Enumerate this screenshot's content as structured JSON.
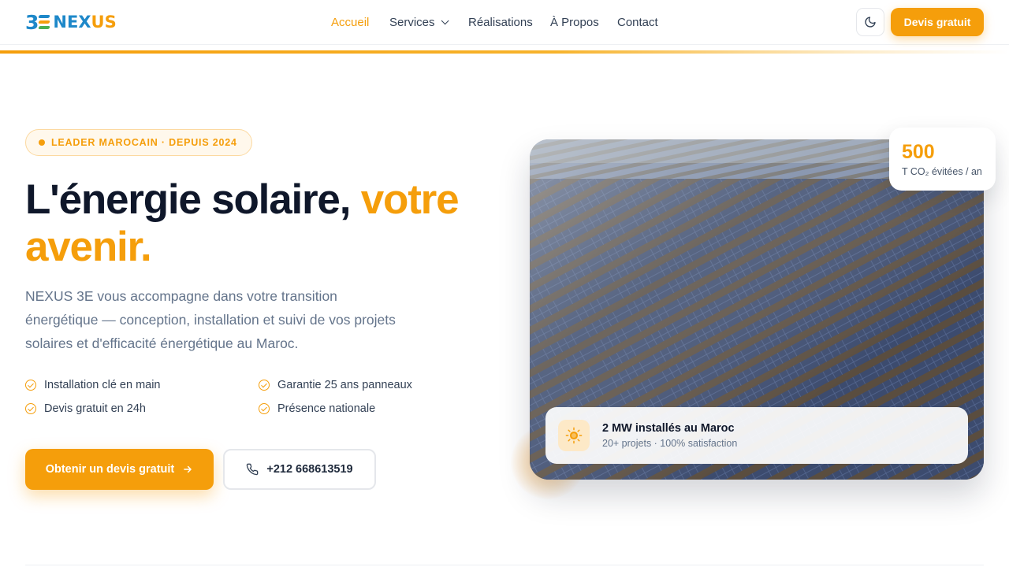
{
  "brand": {
    "logo_mark": "3",
    "logo_text_a": "NEX",
    "logo_text_b": "US",
    "colors": {
      "primary": "#f59e0b",
      "blue": "#1e88c9",
      "green": "#4caf50"
    }
  },
  "nav": {
    "items": [
      {
        "label": "Accueil",
        "active": true
      },
      {
        "label": "Services",
        "has_dropdown": true
      },
      {
        "label": "Réalisations"
      },
      {
        "label": "À Propos"
      },
      {
        "label": "Contact"
      }
    ],
    "theme_toggle_icon": "moon-icon",
    "quote_button": "Devis gratuit"
  },
  "hero": {
    "badge": "LEADER MAROCAIN · DEPUIS 2024",
    "title_main": "L'énergie solaire, ",
    "title_highlight": "votre avenir.",
    "lead": "NEXUS 3E vous accompagne dans votre transition énergétique — conception, installation et suivi de vos projets solaires et d'efficacité énergétique au Maroc.",
    "features": [
      "Installation clé en main",
      "Garantie 25 ans panneaux",
      "Devis gratuit en 24h",
      "Présence nationale"
    ],
    "cta_primary": "Obtenir un devis gratuit",
    "cta_phone": "+212 668613519"
  },
  "stats": {
    "co2_value": "500",
    "co2_label": "T CO₂ évitées / an",
    "installed_title": "2 MW installés au Maroc",
    "installed_sub": "20+ projets · 100% satisfaction",
    "installed_icon": "sun-icon"
  }
}
